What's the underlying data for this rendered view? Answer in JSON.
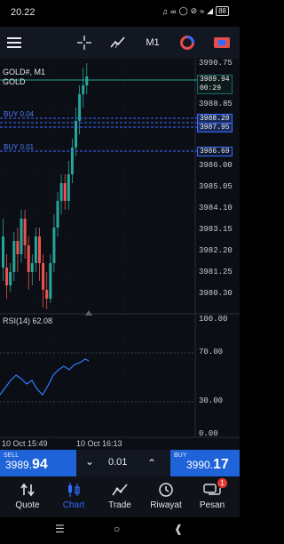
{
  "status_bar": {
    "time": "20.22",
    "icons": [
      "headset-icon",
      "link-icon",
      "shield-icon",
      "mute-icon",
      "wifi-icon",
      "signal-icon"
    ],
    "battery": "88"
  },
  "toolbar": {
    "timeframe": "M1"
  },
  "chart": {
    "symbol_line": "GOLD#, M1",
    "symbol_desc": "GOLD",
    "ask_price": "3989.94",
    "countdown": "00:29",
    "selected_price_1": "3988.20",
    "selected_price_2": "3987.95",
    "buy_level_label_1": "BUY 0.04",
    "buy_level_label_2": "BUY 0.01",
    "buy_level_price": "3986.69",
    "price_ticks": [
      "3990.75",
      "3989.94",
      "3988.85",
      "3988.20",
      "3987.95",
      "3986.69",
      "3986.00",
      "3985.05",
      "3984.10",
      "3983.15",
      "3982.20",
      "3981.25",
      "3980.30"
    ],
    "rsi_label": "RSI(14) 62.08",
    "rsi_ticks": [
      "100.00",
      "70.00",
      "30.00",
      "0.00"
    ],
    "time_labels": [
      "10 Oct 15:49",
      "10 Oct 16:13"
    ]
  },
  "trade": {
    "sell_label": "SELL",
    "sell_price_main": "3989.",
    "sell_price_big": "94",
    "lot": "0.01",
    "buy_label": "BUY",
    "buy_price_main": "3990.",
    "buy_price_big": "17"
  },
  "nav": {
    "items": [
      {
        "label": "Quote"
      },
      {
        "label": "Chart"
      },
      {
        "label": "Trade"
      },
      {
        "label": "Riwayat"
      },
      {
        "label": "Pesan"
      }
    ],
    "badge": "1"
  },
  "colors": {
    "bull": "#26a69a",
    "bear": "#ef5350",
    "accent": "#2e6bff",
    "rsi_line": "#2f7dff"
  }
}
